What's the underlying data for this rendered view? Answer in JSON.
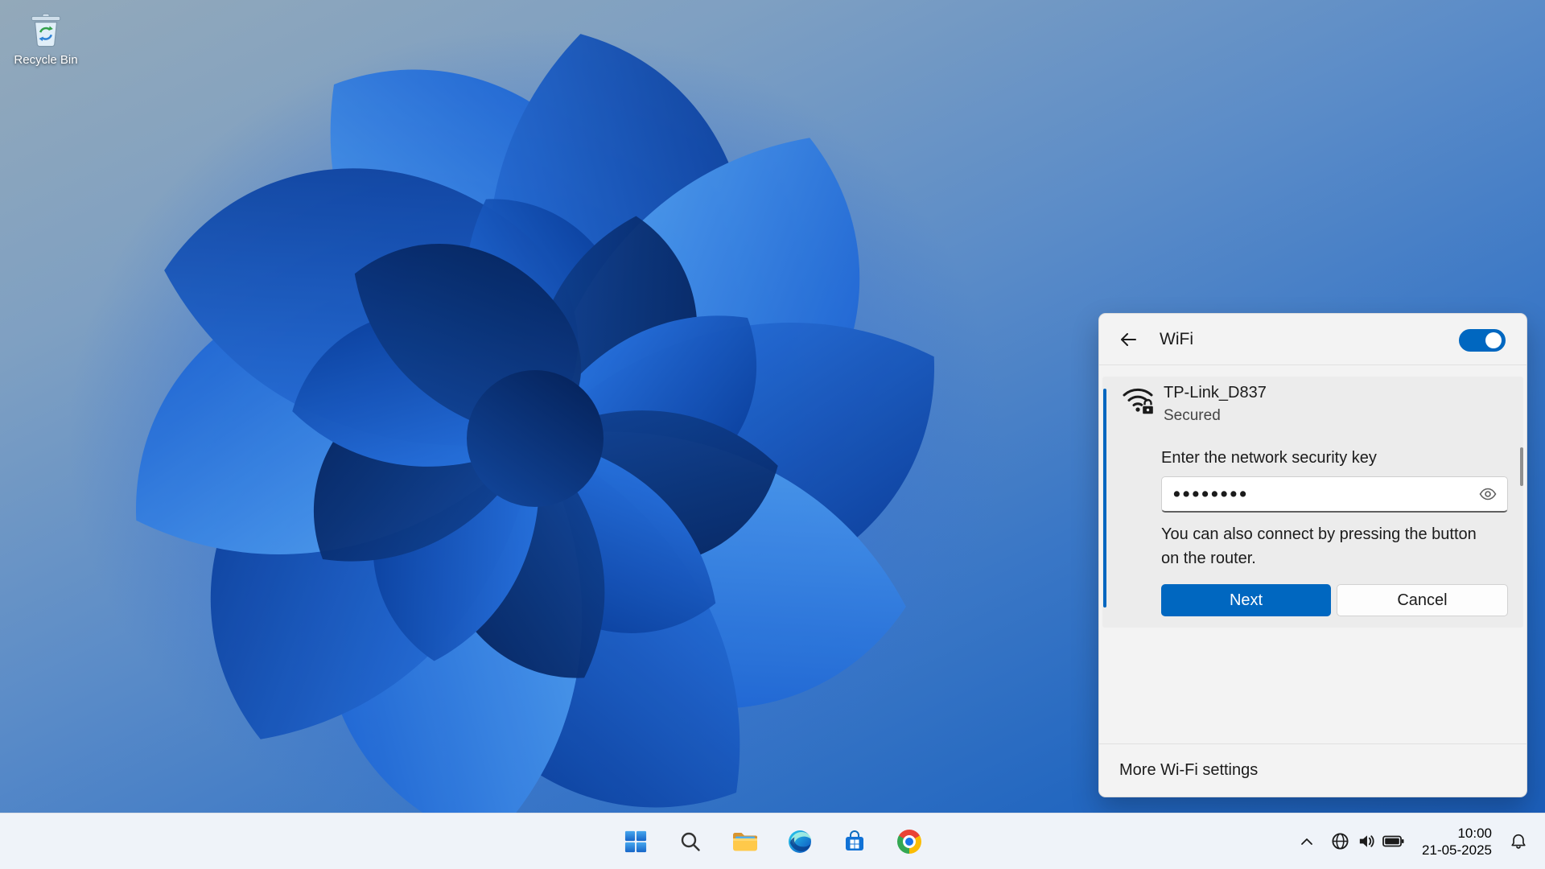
{
  "colors": {
    "accent": "#0067c0",
    "taskbar_bg": "#eff3f9",
    "panel_bg": "#f3f3f3"
  },
  "desktop": {
    "recycle_bin": {
      "label": "Recycle Bin"
    }
  },
  "wifi_panel": {
    "title": "WiFi",
    "toggle": {
      "state": "on"
    },
    "network": {
      "name": "TP-Link_D837",
      "status": "Secured"
    },
    "form": {
      "label": "Enter the network security key",
      "password_masked": "••••••••",
      "hint": "You can also connect by pressing the button on the router.",
      "next_label": "Next",
      "cancel_label": "Cancel"
    },
    "footer": {
      "more_settings": "More Wi-Fi settings"
    }
  },
  "taskbar": {
    "buttons": [
      "start",
      "search",
      "file-explorer",
      "edge",
      "microsoft-store",
      "chrome"
    ],
    "tray": {
      "time": "10:00",
      "date": "21-05-2025"
    }
  },
  "icons": {
    "desktop": [
      "recycle-bin-icon"
    ],
    "panel": [
      "back-arrow-icon",
      "wifi-secured-lock-icon",
      "eye-reveal-icon",
      "toggle-on-switch"
    ],
    "taskbar": [
      "windows-start-icon",
      "search-icon",
      "folder-icon",
      "edge-icon",
      "microsoft-store-icon",
      "chrome-icon"
    ],
    "tray": [
      "chevron-up-icon",
      "globe-icon",
      "speaker-icon",
      "battery-icon",
      "bell-icon"
    ]
  }
}
